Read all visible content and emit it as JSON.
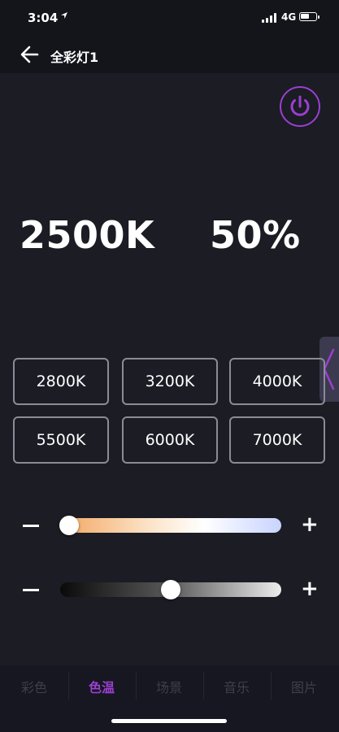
{
  "status_bar": {
    "time": "3:04",
    "location_icon": "location-arrow-icon",
    "network": "4G",
    "battery_level": 0.6
  },
  "header": {
    "back_icon": "arrow-left-icon",
    "title": "全彩灯1"
  },
  "power": {
    "icon": "power-icon",
    "color": "#9b3fd1"
  },
  "readout": {
    "color_temp": "2500K",
    "brightness": "50%"
  },
  "presets": [
    "2800K",
    "3200K",
    "4000K",
    "5500K",
    "6000K",
    "7000K"
  ],
  "sliders": {
    "color_temp": {
      "minus": "−",
      "plus": "+",
      "value": 0.04
    },
    "brightness": {
      "minus": "−",
      "plus": "+",
      "value": 0.5
    }
  },
  "tabs": [
    {
      "label": "彩色",
      "active": false
    },
    {
      "label": "色温",
      "active": true
    },
    {
      "label": "场景",
      "active": false
    },
    {
      "label": "音乐",
      "active": false
    },
    {
      "label": "图片",
      "active": false
    }
  ],
  "colors": {
    "accent": "#9b3fd1",
    "background": "#1b1c24"
  }
}
